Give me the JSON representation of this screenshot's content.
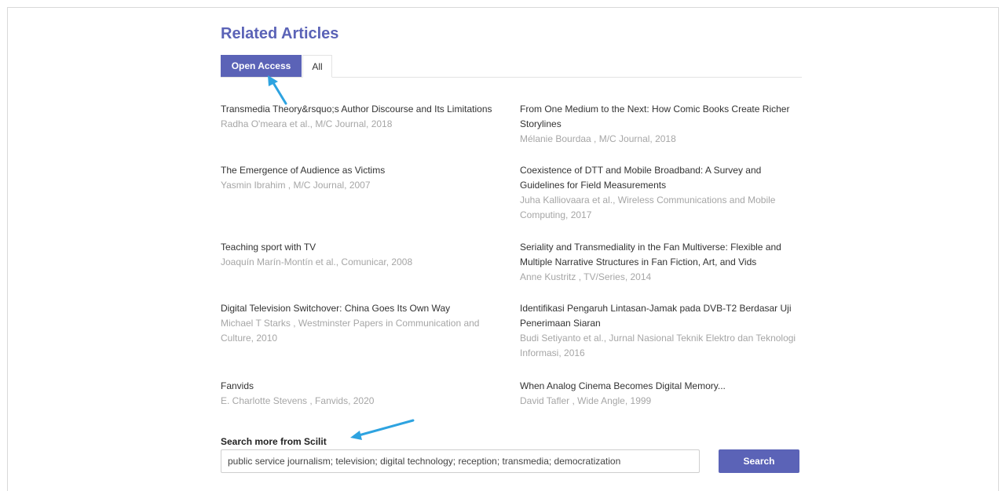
{
  "section": {
    "title": "Related Articles"
  },
  "tabs": [
    {
      "label": "Open Access",
      "active": true
    },
    {
      "label": "All",
      "active": false
    }
  ],
  "articles": [
    {
      "title": "Transmedia Theory&rsquo;s Author Discourse and Its Limitations",
      "meta": "Radha O'meara et al., M/C Journal, 2018"
    },
    {
      "title": "From One Medium to the Next: How Comic Books Create Richer Storylines",
      "meta": "Mélanie Bourdaa , M/C Journal, 2018"
    },
    {
      "title": "The Emergence of Audience as Victims",
      "meta": "Yasmin Ibrahim , M/C Journal, 2007"
    },
    {
      "title": "Coexistence of DTT and Mobile Broadband: A Survey and Guidelines for Field Measurements",
      "meta": "Juha Kalliovaara et al., Wireless Communications and Mobile Computing, 2017"
    },
    {
      "title": "Teaching sport with TV",
      "meta": "Joaquín Marín-Montín et al., Comunicar, 2008"
    },
    {
      "title": "Seriality and Transmediality in the Fan Multiverse: Flexible and Multiple Narrative Structures in Fan Fiction, Art, and Vids",
      "meta": "Anne Kustritz , TV/Series, 2014"
    },
    {
      "title": "Digital Television Switchover: China Goes Its Own Way",
      "meta": "Michael T Starks , Westminster Papers in Communication and Culture, 2010"
    },
    {
      "title": "Identifikasi Pengaruh Lintasan-Jamak pada DVB-T2 Berdasar Uji Penerimaan Siaran",
      "meta": "Budi Setiyanto et al., Jurnal Nasional Teknik Elektro dan Teknologi Informasi, 2016"
    },
    {
      "title": "Fanvids",
      "meta": "E. Charlotte Stevens , Fanvids, 2020"
    },
    {
      "title": "When Analog Cinema Becomes Digital Memory...",
      "meta": "David Tafler , Wide Angle, 1999"
    }
  ],
  "search": {
    "label": "Search more from Scilit",
    "value": "public service journalism; television; digital technology; reception; transmedia; democratization",
    "button_label": "Search"
  },
  "colors": {
    "accent": "#5b63b7",
    "annotation_arrow": "#2ea3e0",
    "meta_text": "#a6a6a6"
  }
}
